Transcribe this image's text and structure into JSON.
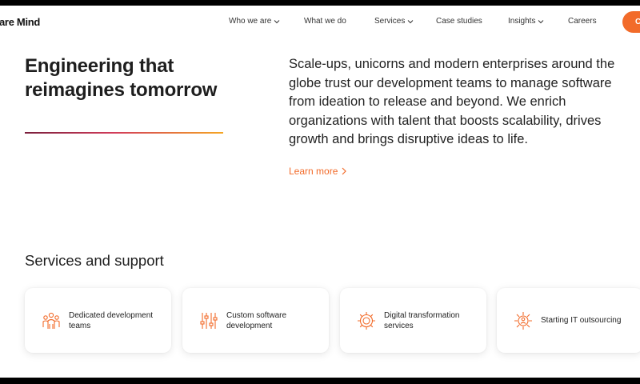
{
  "header": {
    "logo": "are Mind",
    "nav": [
      {
        "label": "Who we are",
        "has_dropdown": true
      },
      {
        "label": "What we do",
        "has_dropdown": false
      },
      {
        "label": "Services",
        "has_dropdown": true
      },
      {
        "label": "Case studies",
        "has_dropdown": false
      },
      {
        "label": "Insights",
        "has_dropdown": true
      },
      {
        "label": "Careers",
        "has_dropdown": false
      }
    ],
    "cta_label": "C",
    "cta_color": "#f26b2a"
  },
  "hero": {
    "title": "Engineering that reimagines tomorrow",
    "text": "Scale-ups, unicorns and modern enterprises around the\nglobe trust our development teams to manage software\nfrom ideation to release and beyond. We enrich\norganizations with talent that boosts scalability, drives\ngrowth and brings disruptive ideas to life.",
    "learn_more": "Learn more"
  },
  "services": {
    "title": "Services and support",
    "cards": [
      {
        "label": "Dedicated development\nteams",
        "icon": "team-icon"
      },
      {
        "label": "Custom software\ndevelopment",
        "icon": "sliders-icon"
      },
      {
        "label": "Digital transformation\nservices",
        "icon": "gear-icon"
      },
      {
        "label": "Starting IT outsourcing",
        "icon": "outsourcing-icon"
      }
    ]
  },
  "colors": {
    "accent": "#f26b2a",
    "text": "#1e1e1e"
  }
}
